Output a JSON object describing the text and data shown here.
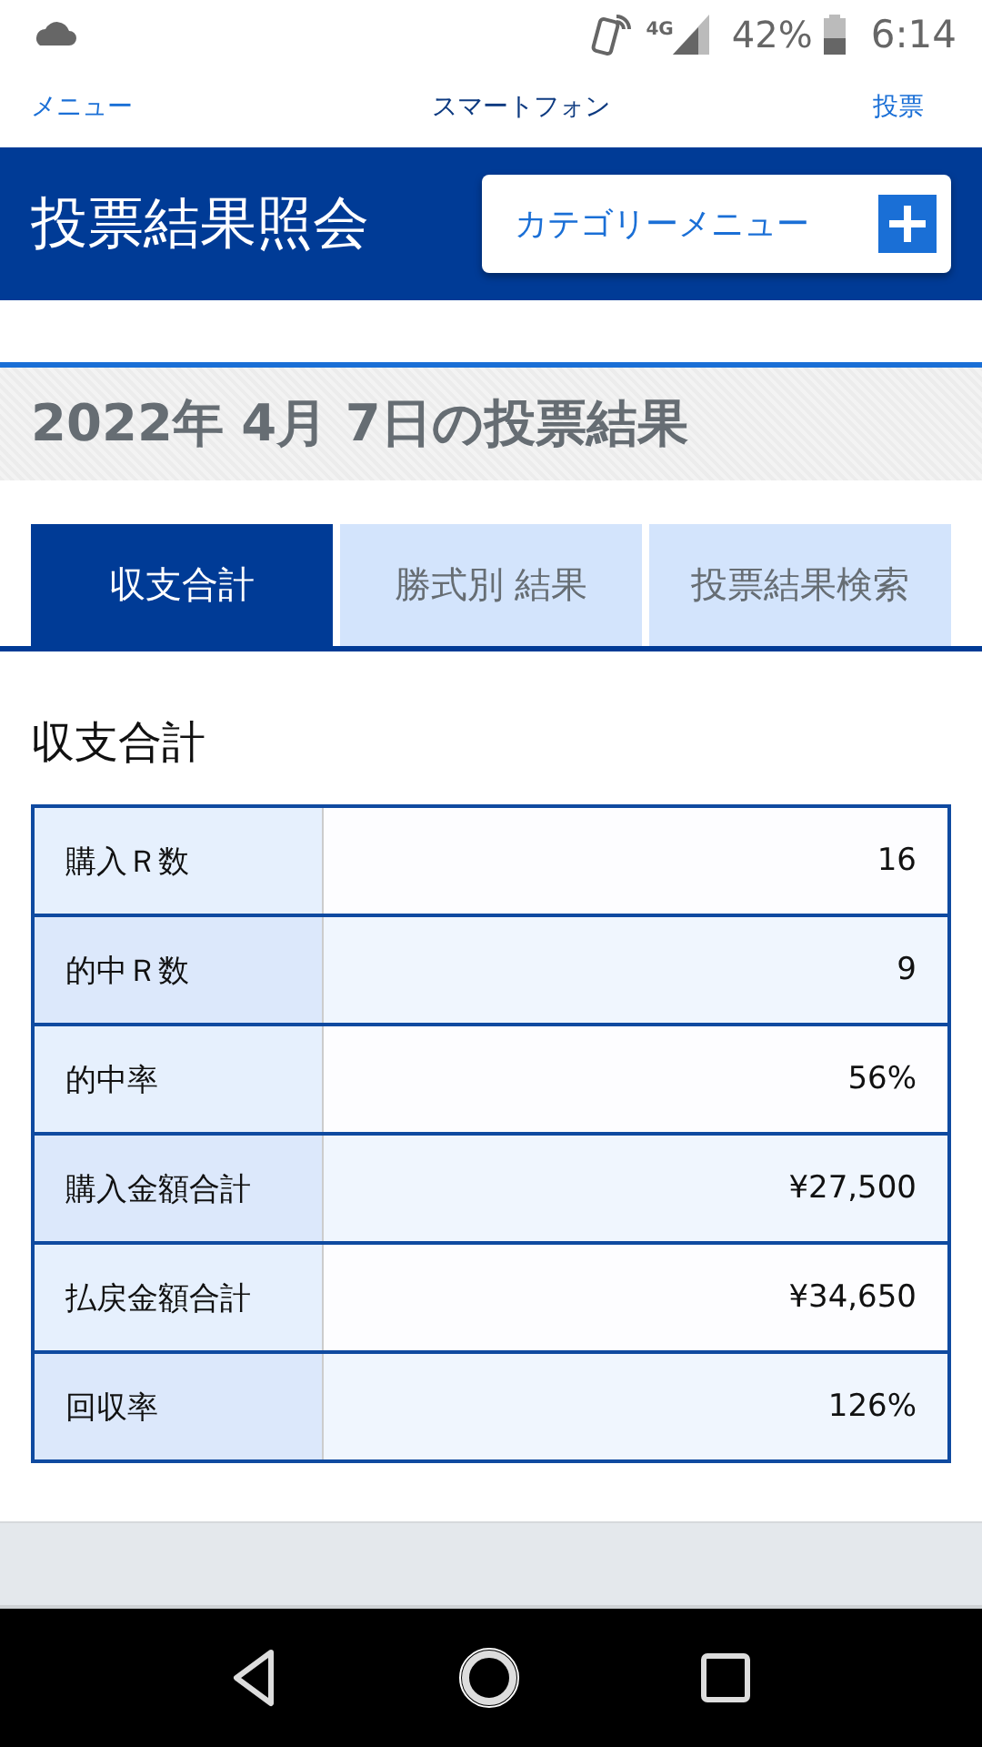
{
  "status_bar": {
    "network": "4G",
    "battery": "42%",
    "time": "6:14"
  },
  "site_nav": {
    "left": "メニュー",
    "center": "スマートフォン",
    "right": "投票"
  },
  "header": {
    "title": "投票結果照会",
    "category_button": "カテゴリーメニュー"
  },
  "date_heading": "2022年 4月 7日の投票結果",
  "tabs": [
    {
      "label": "収支合計",
      "selected": true
    },
    {
      "label": "勝式別 結果",
      "selected": false
    },
    {
      "label": "投票結果検索",
      "selected": false
    }
  ],
  "section_title": "収支合計",
  "summary": [
    {
      "label": "購入Ｒ数",
      "value": "16"
    },
    {
      "label": "的中Ｒ数",
      "value": "9"
    },
    {
      "label": "的中率",
      "value": "56%"
    },
    {
      "label": "購入金額合計",
      "value": "¥27,500"
    },
    {
      "label": "払戻金額合計",
      "value": "¥34,650"
    },
    {
      "label": "回収率",
      "value": "126%"
    }
  ]
}
